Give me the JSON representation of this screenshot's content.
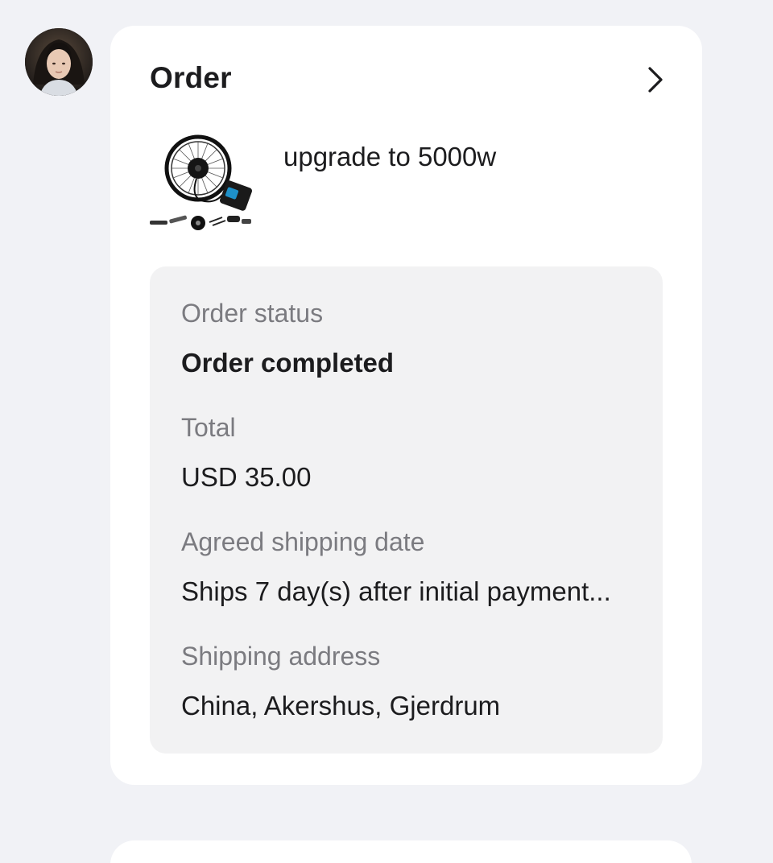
{
  "sender": {
    "avatar_icon": "user-avatar"
  },
  "order_card": {
    "title": "Order",
    "open_icon": "chevron-right-icon",
    "product": {
      "name": "upgrade to 5000w",
      "thumbnail_icon": "ebike-hub-motor-kit"
    },
    "details": {
      "status_label": "Order status",
      "status_value": "Order completed",
      "total_label": "Total",
      "total_value": "USD 35.00",
      "shipping_date_label": "Agreed shipping date",
      "shipping_date_value": "Ships 7 day(s) after initial payment...",
      "address_label": "Shipping address",
      "address_value": "China, Akershus, Gjerdrum"
    }
  },
  "colors": {
    "page_background": "#f1f2f6",
    "card_background": "#ffffff",
    "details_background": "#f2f2f3",
    "primary_text": "#1c1c1e",
    "secondary_text": "#7b7b80"
  }
}
